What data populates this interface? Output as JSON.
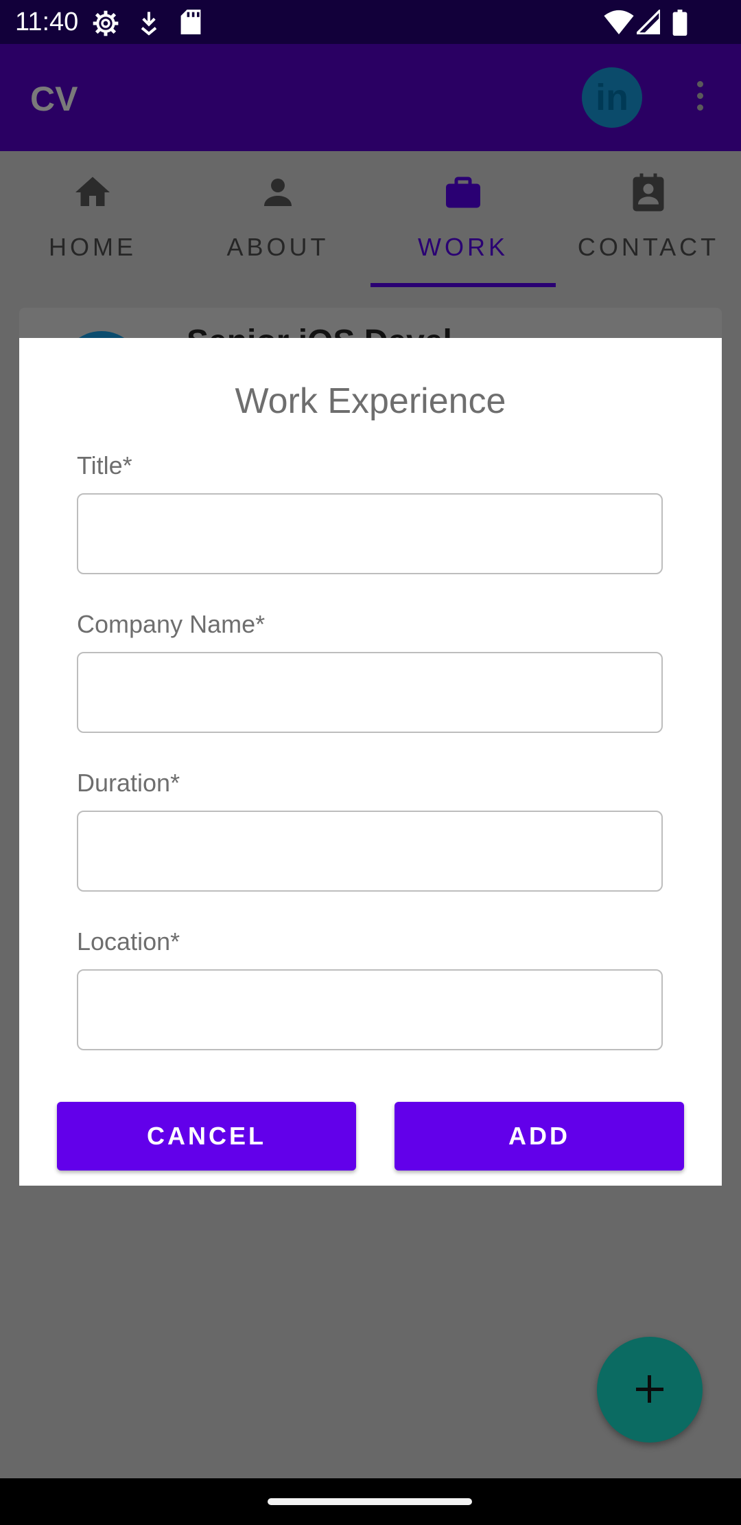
{
  "status_bar": {
    "time": "11:40",
    "icons": [
      "settings-icon",
      "download-icon",
      "sd-card-icon",
      "wifi-icon",
      "signal-icon",
      "battery-icon"
    ]
  },
  "app_bar": {
    "title": "CV",
    "linkedin_label": "in"
  },
  "tabs": [
    {
      "label": "HOME",
      "icon": "home-icon",
      "selected": false
    },
    {
      "label": "ABOUT",
      "icon": "person-icon",
      "selected": false
    },
    {
      "label": "WORK",
      "icon": "briefcase-icon",
      "selected": true
    },
    {
      "label": "CONTACT",
      "icon": "contact-icon",
      "selected": false
    }
  ],
  "background_card": {
    "title": "Senior iOS Devel"
  },
  "dialog": {
    "title": "Work Experience",
    "fields": [
      {
        "label": "Title*",
        "value": "",
        "placeholder": ""
      },
      {
        "label": "Company Name*",
        "value": "",
        "placeholder": ""
      },
      {
        "label": "Duration*",
        "value": "",
        "placeholder": ""
      },
      {
        "label": "Location*",
        "value": "",
        "placeholder": ""
      }
    ],
    "cancel_label": "CANCEL",
    "add_label": "ADD"
  },
  "fab": {
    "icon": "plus-icon"
  },
  "colors": {
    "primary": "#6200ea",
    "app_bar_dimmed": "#2a0063",
    "selected_tab": "#2a0073",
    "fab": "#0b6b62",
    "scrim": "#686868"
  }
}
